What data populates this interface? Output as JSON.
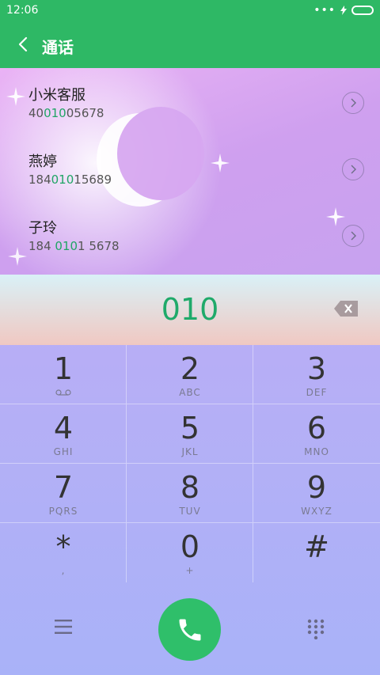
{
  "status": {
    "time": "12:06",
    "icons": [
      "more-dots-icon",
      "charging-bolt-icon",
      "battery-icon"
    ]
  },
  "header": {
    "title": "通话",
    "back_icon": "back-chevron-icon"
  },
  "results": [
    {
      "name": "小米客服",
      "number_pre": "40",
      "number_hl": "010",
      "number_post": "05678"
    },
    {
      "name": "燕婷",
      "number_pre": "184",
      "number_hl": "010",
      "number_post": "15689"
    },
    {
      "name": "子玲",
      "number_pre": "184 ",
      "number_hl": "010",
      "number_post": "1 5678"
    }
  ],
  "input": {
    "digits": "010",
    "backspace_icon": "backspace-icon"
  },
  "keypad": [
    {
      "main": "1",
      "sub": ""
    },
    {
      "main": "2",
      "sub": "ABC"
    },
    {
      "main": "3",
      "sub": "DEF"
    },
    {
      "main": "4",
      "sub": "GHI"
    },
    {
      "main": "5",
      "sub": "JKL"
    },
    {
      "main": "6",
      "sub": "MNO"
    },
    {
      "main": "7",
      "sub": "PQRS"
    },
    {
      "main": "8",
      "sub": "TUV"
    },
    {
      "main": "9",
      "sub": "WXYZ"
    },
    {
      "main": "*",
      "sub": ","
    },
    {
      "main": "0",
      "sub": "+"
    },
    {
      "main": "#",
      "sub": ""
    }
  ],
  "bottom": {
    "menu_icon": "menu-icon",
    "call_icon": "phone-icon",
    "dialpad_icon": "dialpad-icon"
  },
  "colors": {
    "accent": "#2eb865",
    "highlight": "#20a565",
    "call_button": "#2fbf6a"
  }
}
